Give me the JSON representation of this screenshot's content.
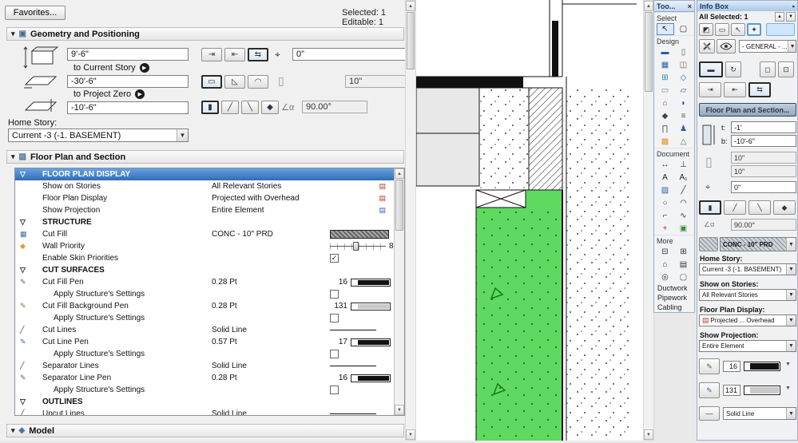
{
  "dialog": {
    "favorites_button": "Favorites...",
    "status": "Selected: 1 Editable: 1",
    "geometry": {
      "title": "Geometry and Positioning",
      "height": "9'-6\"",
      "to_current_story": "to Current Story",
      "base_elevation": "-30'-6\"",
      "to_project_zero": "to Project Zero",
      "base_offset": "-10'-6\"",
      "end_offset": "0\"",
      "thickness": "10\"",
      "angle": "90.00°",
      "home_story_label": "Home Story:",
      "home_story": "Current -3 (-1. BASEMENT)"
    },
    "floor_plan_panel": {
      "title": "Floor Plan and Section"
    },
    "model_panel": {
      "title": "Model"
    },
    "table_rows": [
      {
        "type": "group_selected",
        "label": "FLOOR PLAN DISPLAY"
      },
      {
        "type": "value",
        "label": "Show on Stories",
        "value": "All Relevant Stories",
        "right_icon": "stories-badge-icon"
      },
      {
        "type": "value",
        "label": "Floor Plan Display",
        "value": "Projected with Overhead",
        "right_icon": "display-badge-icon"
      },
      {
        "type": "value",
        "label": "Show Projection",
        "value": "Entire Element",
        "right_icon": "projection-badge-icon"
      },
      {
        "type": "group",
        "label": "STRUCTURE"
      },
      {
        "type": "fill",
        "icon": "cut-fill-icon",
        "label": "Cut Fill",
        "value": "CONC - 10\" PRD"
      },
      {
        "type": "slider",
        "icon": "wall-priority-icon",
        "label": "Wall Priority",
        "value": "8"
      },
      {
        "type": "check",
        "label": "Enable Skin Priorities",
        "checked": true
      },
      {
        "type": "group",
        "label": "CUT SURFACES"
      },
      {
        "type": "pen",
        "icon": "pen-icon",
        "label": "Cut Fill Pen",
        "value": "0.28 Pt",
        "pen": "16",
        "pen_color": "#111111"
      },
      {
        "type": "check",
        "label": "Apply Structure's Settings",
        "checked": false,
        "indent": true
      },
      {
        "type": "pen",
        "icon": "pen-bg-icon",
        "label": "Cut Fill Background Pen",
        "value": "0.28 Pt",
        "pen": "131",
        "pen_color": "#c9c9c9"
      },
      {
        "type": "check",
        "label": "Apply Structure's Settings",
        "checked": false,
        "indent": true
      },
      {
        "type": "line",
        "icon": "line-type-icon",
        "label": "Cut Lines",
        "value": "Solid Line"
      },
      {
        "type": "pen",
        "icon": "pen-icon",
        "label": "Cut Line Pen",
        "value": "0.57 Pt",
        "pen": "17",
        "pen_color": "#111111"
      },
      {
        "type": "check",
        "label": "Apply Structure's Settings",
        "checked": false,
        "indent": true
      },
      {
        "type": "line",
        "icon": "line-type-icon",
        "label": "Separator Lines",
        "value": "Solid Line"
      },
      {
        "type": "pen",
        "icon": "pen-icon",
        "label": "Separator Line Pen",
        "value": "0.28 Pt",
        "pen": "16",
        "pen_color": "#111111"
      },
      {
        "type": "check",
        "label": "Apply Structure's Settings",
        "checked": false,
        "indent": true
      },
      {
        "type": "group",
        "label": "OUTLINES"
      },
      {
        "type": "line",
        "icon": "line-type-icon",
        "label": "Uncut Lines",
        "value": "Solid Line"
      }
    ]
  },
  "toolbox": {
    "title": "Too...",
    "close": "×",
    "selected_tool": "arrow-tool",
    "sections": [
      {
        "label": "Select",
        "tools": [
          "arrow-tool",
          "marquee-tool"
        ]
      },
      {
        "label": "Design",
        "tools": [
          "wall-tool",
          "column-tool",
          "curtain-wall-tool",
          "door-tool",
          "window-tool",
          "skylight-tool",
          "beam-tool",
          "slab-tool",
          "roof-tool",
          "shell-tool",
          "morph-tool",
          "stair-tool",
          "railing-tool",
          "object-tool",
          "zone-tool",
          "mesh-tool"
        ]
      },
      {
        "label": "Document",
        "tools": [
          "dimension-tool",
          "level-dimension-tool",
          "text-tool",
          "label-tool",
          "fill-tool",
          "line-tool",
          "circle-tool",
          "arc-tool",
          "polyline-tool",
          "spline-tool",
          "hotspot-tool",
          "figure-tool"
        ]
      },
      {
        "label": "More",
        "tools": [
          "section-tool",
          "elevation-tool",
          "interior-elevation-tool",
          "worksheet-tool",
          "detail-tool",
          "camera-tool"
        ]
      }
    ],
    "extra_items": [
      "Ductwork",
      "Pipework",
      "Cabling"
    ]
  },
  "infobox": {
    "title": "Info Box",
    "status": "All Selected: 1",
    "general_selector": "- GENERAL - ...",
    "panel_button": "Floor Plan and Section...",
    "top_label": "t:",
    "bottom_label": "b:",
    "top_elev": "-1'",
    "bottom_elev": "-10'-6\"",
    "width_a": "10\"",
    "width_b": "10\"",
    "offset": "0\"",
    "angle": "90.00°",
    "fill_name": "CONC - 10\" PRD",
    "home_story_label": "Home Story:",
    "home_story": "Current -3 (-1. BASEMENT)",
    "show_on_stories_label": "Show on Stories:",
    "show_on_stories": "All Relevant Stories",
    "floor_plan_display_label": "Floor Plan Display:",
    "floor_plan_display": "Projected ... Overhead",
    "show_projection_label": "Show Projection:",
    "show_projection": "Entire Element",
    "cut_pen": "16",
    "background_pen": "131",
    "line_type": "Solid Line"
  }
}
